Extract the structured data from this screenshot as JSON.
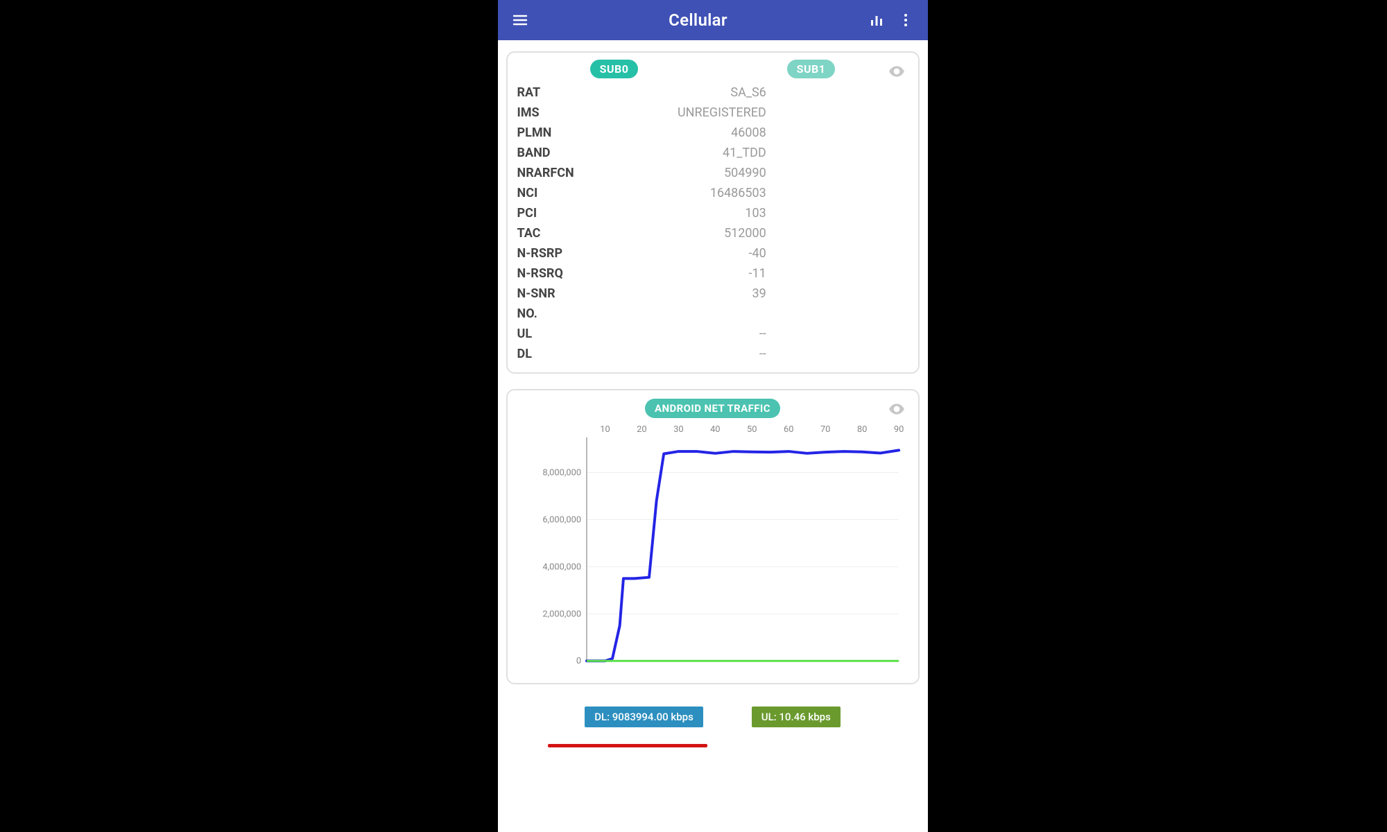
{
  "appbar": {
    "title": "Cellular"
  },
  "subs": {
    "sub0": "SUB0",
    "sub1": "SUB1"
  },
  "rows": [
    {
      "key": "RAT",
      "v0": "SA_S6",
      "v1": ""
    },
    {
      "key": "IMS",
      "v0": "UNREGISTERED",
      "v1": ""
    },
    {
      "key": "PLMN",
      "v0": "46008",
      "v1": ""
    },
    {
      "key": "BAND",
      "v0": "41_TDD",
      "v1": ""
    },
    {
      "key": "NRARFCN",
      "v0": "504990",
      "v1": ""
    },
    {
      "key": "NCI",
      "v0": "16486503",
      "v1": ""
    },
    {
      "key": "PCI",
      "v0": "103",
      "v1": ""
    },
    {
      "key": "TAC",
      "v0": "512000",
      "v1": ""
    },
    {
      "key": "N-RSRP",
      "v0": "-40",
      "v1": ""
    },
    {
      "key": "N-RSRQ",
      "v0": "-11",
      "v1": ""
    },
    {
      "key": "N-SNR",
      "v0": "39",
      "v1": ""
    },
    {
      "key": "NO.",
      "v0": "",
      "v1": ""
    },
    {
      "key": "UL",
      "v0": "--",
      "v1": ""
    },
    {
      "key": "DL",
      "v0": "--",
      "v1": ""
    }
  ],
  "chart": {
    "title": "ANDROID NET TRAFFIC"
  },
  "legend": {
    "dl": "DL: 9083994.00 kbps",
    "ul": "UL: 10.46 kbps"
  },
  "chart_data": {
    "type": "line",
    "title": "ANDROID NET TRAFFIC",
    "xlabel": "",
    "ylabel": "",
    "x_ticks": [
      10,
      20,
      30,
      40,
      50,
      60,
      70,
      80,
      90
    ],
    "y_ticks": [
      0,
      2000000,
      4000000,
      6000000,
      8000000
    ],
    "xlim": [
      5,
      90
    ],
    "ylim": [
      0,
      9500000
    ],
    "series": [
      {
        "name": "DL",
        "unit": "kbps",
        "current": 9083994.0,
        "color": "#2424e6",
        "x": [
          5,
          10,
          12,
          14,
          15,
          18,
          22,
          24,
          26,
          28,
          30,
          35,
          40,
          45,
          50,
          55,
          60,
          65,
          70,
          75,
          80,
          85,
          90
        ],
        "values": [
          0,
          0,
          100000,
          1500000,
          3500000,
          3500000,
          3550000,
          6800000,
          8800000,
          8850000,
          8900000,
          8900000,
          8820000,
          8900000,
          8880000,
          8870000,
          8900000,
          8820000,
          8870000,
          8900000,
          8880000,
          8830000,
          8950000
        ]
      },
      {
        "name": "UL",
        "unit": "kbps",
        "current": 10.46,
        "color": "#5de04a",
        "x": [
          5,
          90
        ],
        "values": [
          10,
          10
        ]
      }
    ]
  }
}
